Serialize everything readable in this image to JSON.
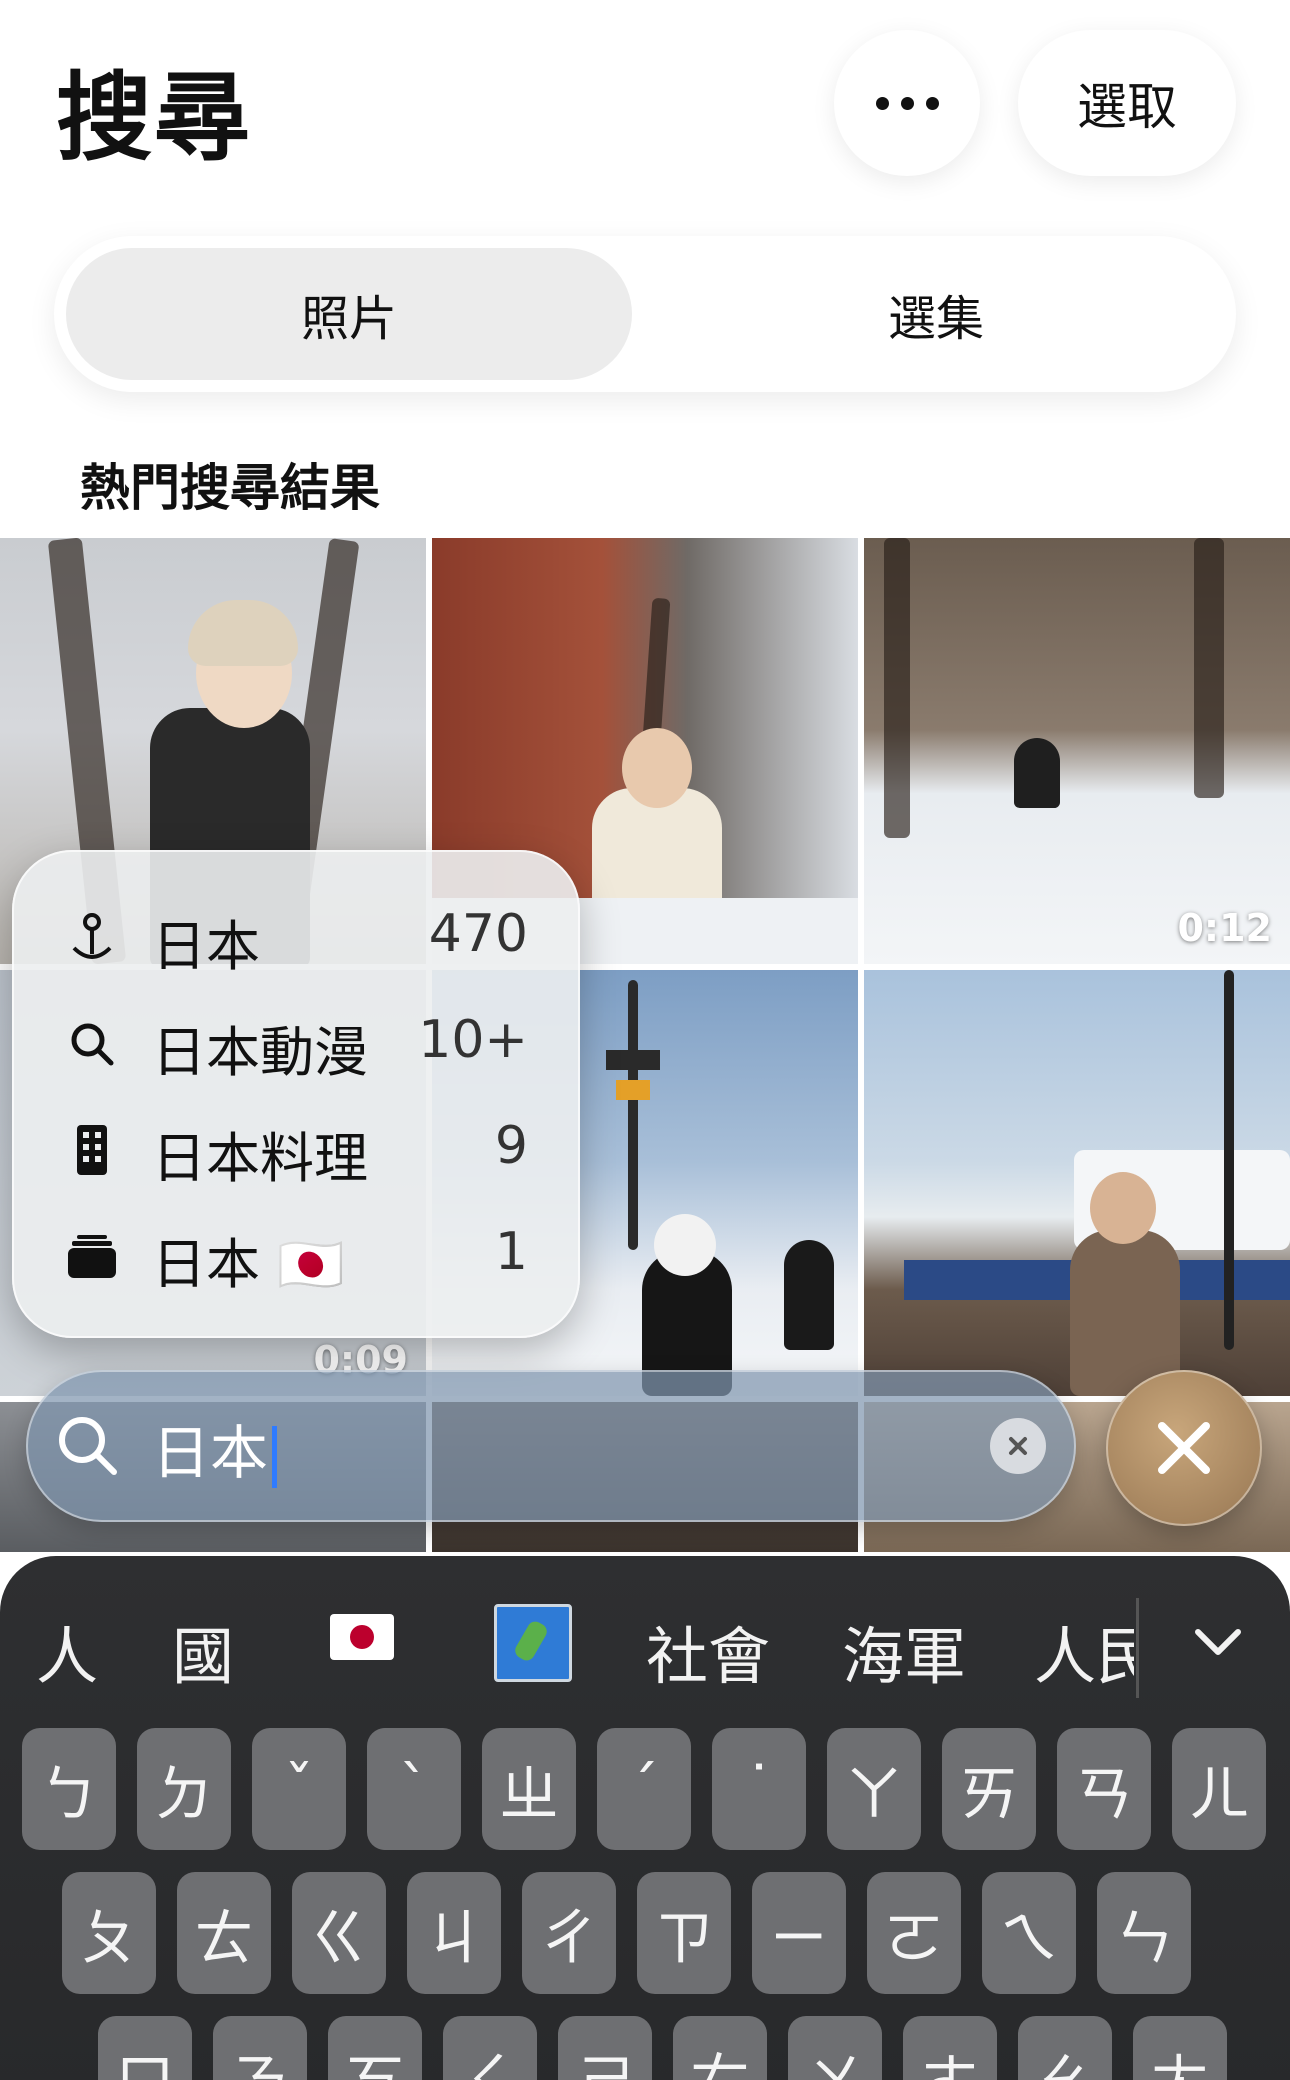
{
  "header": {
    "title": "搜尋",
    "select_label": "選取"
  },
  "segment": {
    "tabs": [
      "照片",
      "選集"
    ],
    "active_index": 0
  },
  "section_title": "熱門搜尋結果",
  "photos": {
    "p3_duration": "0:12",
    "p4_duration": "0:09"
  },
  "suggestions": [
    {
      "icon": "map-pin-icon",
      "label": "日本",
      "count": "470"
    },
    {
      "icon": "search-icon",
      "label": "日本動漫",
      "count": "10+"
    },
    {
      "icon": "building-icon",
      "label": "日本料理",
      "count": "9"
    },
    {
      "icon": "album-stack-icon",
      "label": "日本",
      "emoji": "🇯🇵",
      "count": "1"
    }
  ],
  "search": {
    "query": "日本"
  },
  "keyboard": {
    "candidates": [
      "人",
      "國",
      "社會",
      "海軍",
      "人民"
    ],
    "row1": [
      "ㄅ",
      "ㄉ",
      "ˇ",
      "ˋ",
      "ㄓ",
      "ˊ",
      "˙",
      "ㄚ",
      "ㄞ",
      "ㄢ",
      "ㄦ"
    ],
    "row2": [
      "ㄆ",
      "ㄊ",
      "ㄍ",
      "ㄐ",
      "ㄔ",
      "ㄗ",
      "ㄧ",
      "ㄛ",
      "ㄟ",
      "ㄣ"
    ],
    "row3": [
      "ㄇ",
      "ㄋ",
      "ㄎ",
      "ㄑ",
      "ㄕ",
      "ㄘ",
      "ㄨ",
      "ㄜ",
      "ㄠ",
      "ㄤ"
    ]
  },
  "colors": {
    "caret": "#2f7bff",
    "keyboard_bg": "#2e2f31",
    "key_bg": "#6e6f72"
  }
}
